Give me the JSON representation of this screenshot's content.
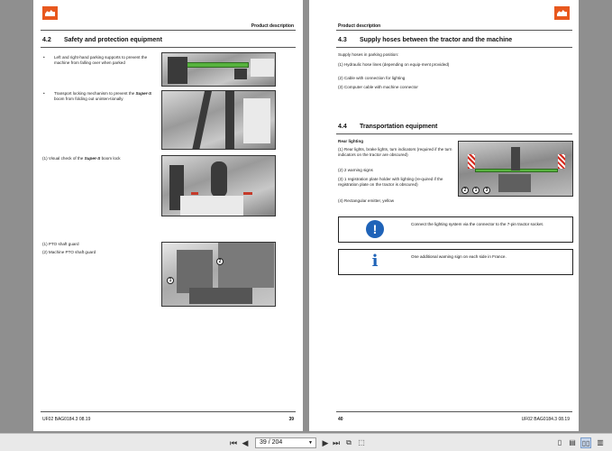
{
  "viewer": {
    "page_current": "39",
    "page_total": "204",
    "page_display": "39 / 204"
  },
  "left_page": {
    "header": "Product description",
    "section": {
      "num": "4.2",
      "title": "Safety and protection equipment"
    },
    "bullet1": "Left and right-hand parking supports to prevent the machine from falling over when parked",
    "bullet2a": "Transport locking mechanism to prevent the",
    "bullet2brand": "Super-S",
    "bullet2b": "boom from folding out uninten-tionally",
    "item1a": "(1)  Visual check of the",
    "item1brand": "Super-S",
    "item1b": "boom lock",
    "pto1": "(1)   PTO shaft guard",
    "pto2": "(2)   Machine PTO shaft guard",
    "callout1": "1",
    "callout2": "2",
    "footer_left": "UF02  BAG0184.3  08.19",
    "footer_page": "39"
  },
  "right_page": {
    "header": "Product description",
    "section1": {
      "num": "4.3",
      "title": "Supply hoses between the tractor and the machine"
    },
    "intro": "Supply hoses in parking position:",
    "hoses": [
      "(1)   Hydraulic hose lines (depending on equip-ment provided)",
      "(2)   Cable with connection for lighting",
      "(3)   Computer cable with machine connector"
    ],
    "section2": {
      "num": "4.4",
      "title": "Transportation equipment"
    },
    "rear_lighting": "Rear lighting",
    "lights": [
      "(1)   Rear lights, brake lights, turn indicators (required if the turn indicators on the tractor are obscured)",
      "(2)   2 warning signs",
      "(3)   1 registration plate holder with lighting (re-quired if the registration plate on the tractor is obscured)",
      "(4)   Rectangular emitter, yellow"
    ],
    "callouts": [
      "2",
      "1",
      "3"
    ],
    "note1": "Connect the lighting system via the connector to the 7-pin tractor socket.",
    "note2": "One additional warning sign on each side in France.",
    "note1_icon": "!",
    "note2_icon": "i",
    "footer_page": "40",
    "footer_right": "UF02  BAG0184.3  08.19"
  },
  "colors": {
    "logo": "#e8581e",
    "info_blue": "#1f63b8",
    "machine_green": "#57b33e"
  }
}
